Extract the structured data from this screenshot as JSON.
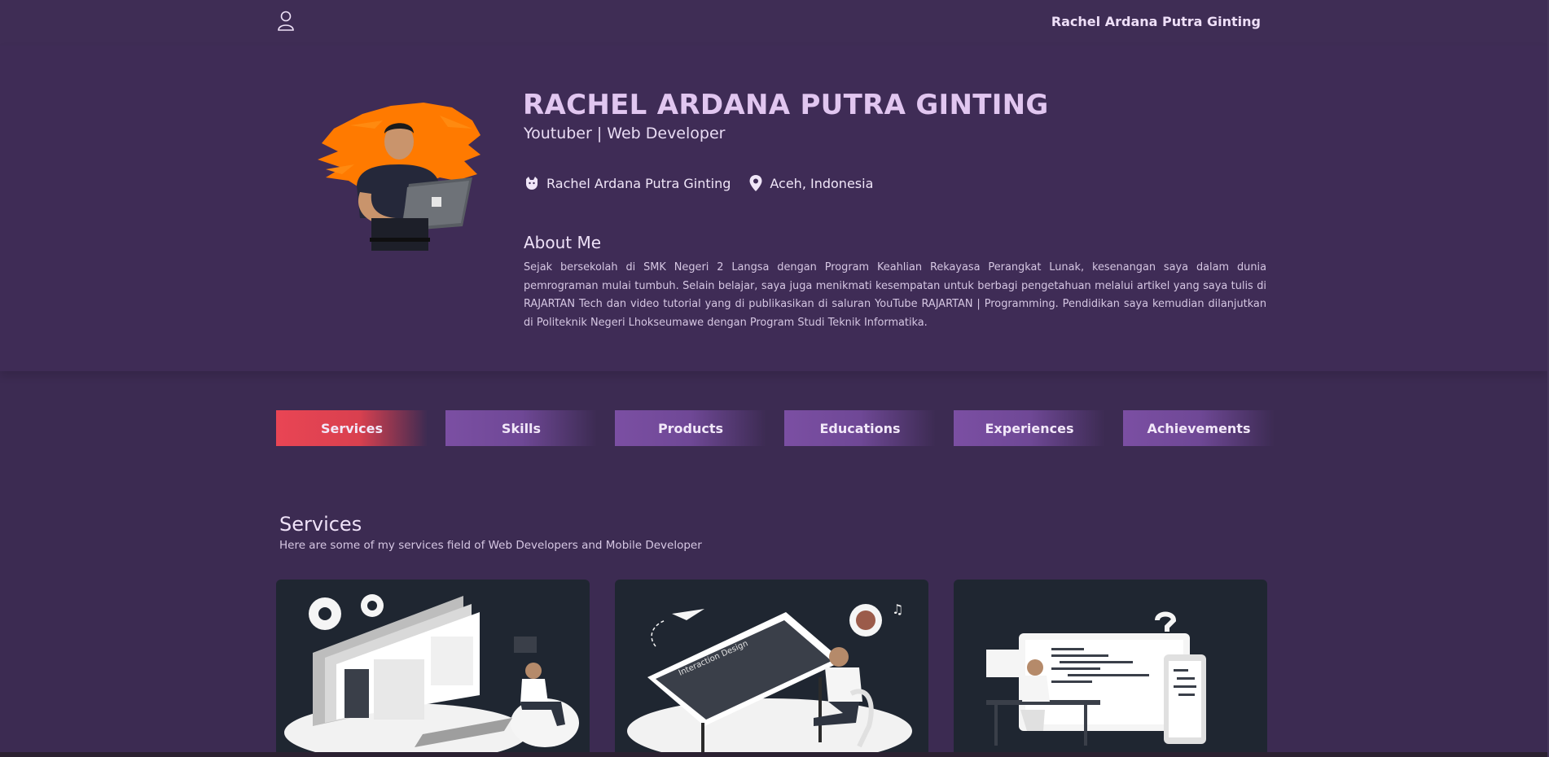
{
  "nav": {
    "brand": "Rachel Ardana Putra Ginting",
    "user_icon": "user-icon"
  },
  "profile": {
    "name": "RACHEL ARDANA PUTRA GINTING",
    "subtitle": "Youtuber | Web Developer",
    "github": "Rachel Ardana Putra Ginting",
    "location": "Aceh, Indonesia",
    "about_title": "About Me",
    "about_text": "Sejak bersekolah di SMK Negeri 2 Langsa dengan Program Keahlian Rekayasa Perangkat Lunak, kesenangan saya dalam dunia pemrograman mulai tumbuh. Selain belajar, saya juga menikmati kesempatan untuk berbagi pengetahuan melalui artikel yang saya tulis di RAJARTAN Tech dan video tutorial yang di publikasikan di saluran YouTube RAJARTAN | Programming. Pendidikan saya kemudian dilanjutkan di Politeknik Negeri Lhokseumawe dengan Program Studi Teknik Informatika."
  },
  "tabs": [
    {
      "label": "Services",
      "active": true
    },
    {
      "label": "Skills",
      "active": false
    },
    {
      "label": "Products",
      "active": false
    },
    {
      "label": "Educations",
      "active": false
    },
    {
      "label": "Experiences",
      "active": false
    },
    {
      "label": "Achievements",
      "active": false
    }
  ],
  "services": {
    "title": "Services",
    "subtitle": "Here are some of my services field of Web Developers and Mobile Developer",
    "cards": [
      {
        "illustration": "web-development-illustration"
      },
      {
        "illustration": "interaction-design-illustration",
        "caption": "Interaction Design"
      },
      {
        "illustration": "mobile-development-illustration"
      }
    ]
  },
  "colors": {
    "background": "#3c2b52",
    "accent_active_tab": "#e94554",
    "tab": "#7b4fa3",
    "name": "#e1c6f0",
    "card": "#1f2631"
  }
}
